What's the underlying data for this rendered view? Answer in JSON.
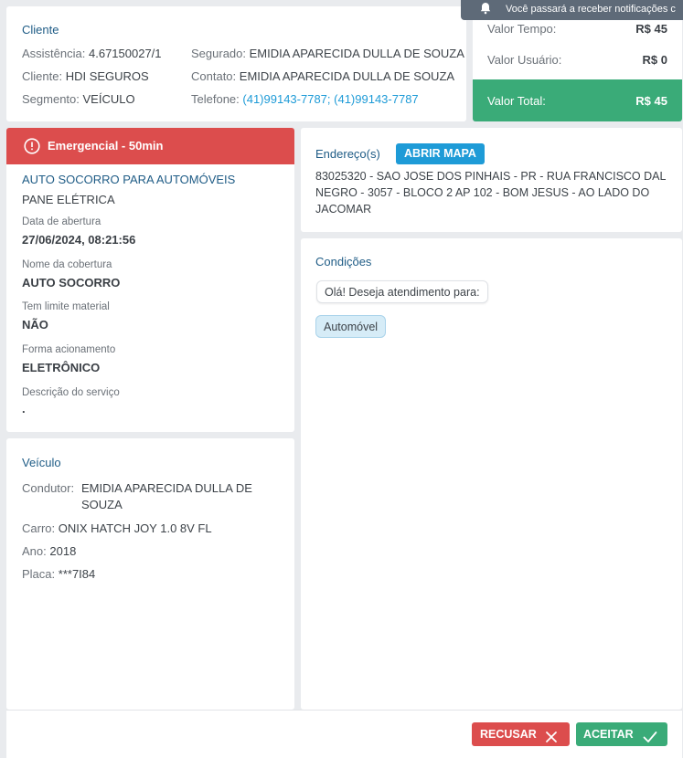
{
  "toast": {
    "text": "Você passará a receber notificações c"
  },
  "cliente": {
    "title": "Cliente",
    "assistencia_label": "Assistência:",
    "assistencia": "4.67150027/1",
    "cliente_label": "Cliente:",
    "cliente": "HDI SEGUROS",
    "segmento_label": "Segmento:",
    "segmento": "VEÍCULO",
    "segurado_label": "Segurado:",
    "segurado": "EMIDIA APARECIDA DULLA DE SOUZA",
    "contato_label": "Contato:",
    "contato": "EMIDIA APARECIDA DULLA DE SOUZA",
    "telefone_label": "Telefone:",
    "telefone": "(41)99143-7787; (41)99143-7787"
  },
  "valores": {
    "tempo_label": "Valor Tempo:",
    "tempo": "R$ 45",
    "usuario_label": "Valor Usuário:",
    "usuario": "R$ 0",
    "total_label": "Valor Total:",
    "total": "R$ 45"
  },
  "servico": {
    "badge": "Emergencial - 50min",
    "tipo": "AUTO SOCORRO PARA AUTOMÓVEIS",
    "problema": "PANE ELÉTRICA",
    "data_label": "Data de abertura",
    "data": "27/06/2024, 08:21:56",
    "cobertura_label": "Nome da cobertura",
    "cobertura": "AUTO SOCORRO",
    "limite_label": "Tem limite material",
    "limite": "NÃO",
    "acionamento_label": "Forma acionamento",
    "acionamento": "ELETRÔNICO",
    "descricao_label": "Descrição do serviço",
    "descricao": "."
  },
  "endereco": {
    "title": "Endereço(s)",
    "map_button": "ABRIR MAPA",
    "line1": "83025320 - SAO JOSE DOS PINHAIS - PR - RUA FRANCISCO DAL",
    "line2": "NEGRO - 3057 - BLOCO 2 AP 102 - BOM JESUS - AO LADO DO",
    "line3": "JACOMAR"
  },
  "condicoes": {
    "title": "Condições",
    "question": "Olá! Deseja atendimento para:",
    "answer": "Automóvel"
  },
  "veiculo": {
    "title": "Veículo",
    "condutor_label": "Condutor:",
    "condutor_line1": "EMIDIA APARECIDA DULLA DE",
    "condutor_line2": "SOUZA",
    "carro_label": "Carro:",
    "carro": "ONIX HATCH JOY 1.0 8V FL",
    "ano_label": "Ano:",
    "ano": "2018",
    "placa_label": "Placa:",
    "placa": "***7I84"
  },
  "footer": {
    "recusar": "RECUSAR",
    "aceitar": "ACEITAR"
  },
  "colors": {
    "emergency": "#dc4d4d",
    "total": "#3aab78",
    "accept": "#3aab78",
    "refuse": "#dc4d4d",
    "link": "#1e9bd7"
  }
}
